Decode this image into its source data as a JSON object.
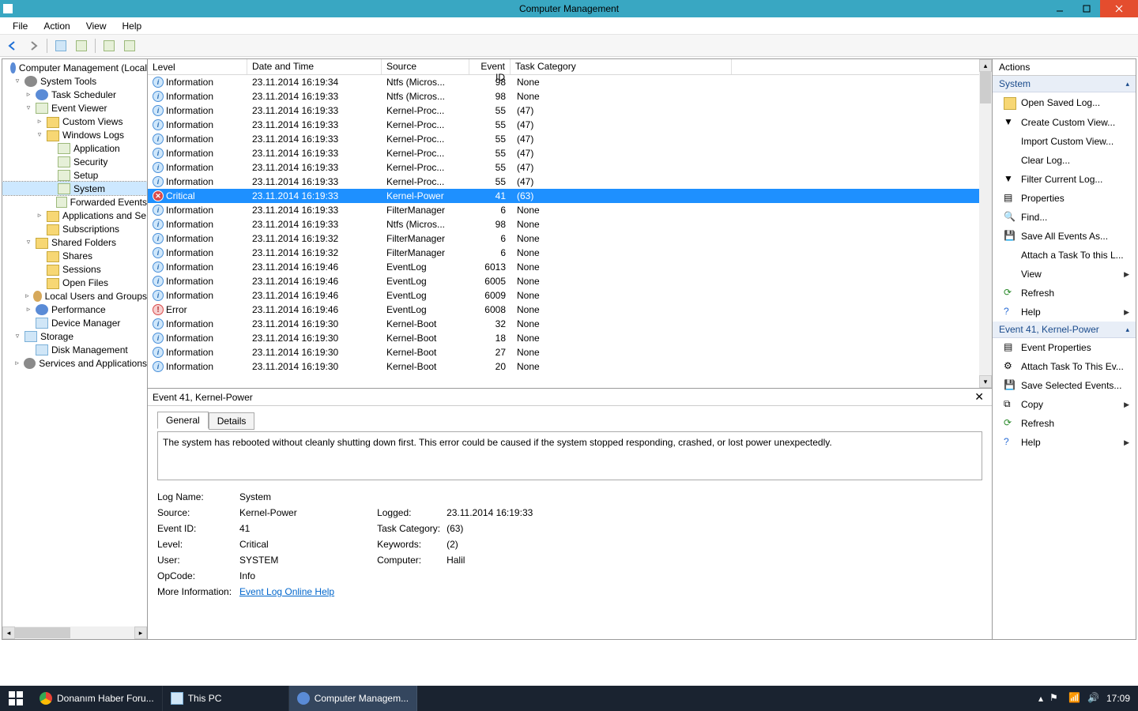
{
  "window": {
    "title": "Computer Management"
  },
  "menu": [
    "File",
    "Action",
    "View",
    "Help"
  ],
  "tree": [
    {
      "lvl": 0,
      "tw": "",
      "icon": "tool",
      "label": "Computer Management (Local"
    },
    {
      "lvl": 1,
      "tw": "▿",
      "icon": "gear",
      "label": "System Tools"
    },
    {
      "lvl": 2,
      "tw": "▹",
      "icon": "tool",
      "label": "Task Scheduler"
    },
    {
      "lvl": 2,
      "tw": "▿",
      "icon": "log",
      "label": "Event Viewer"
    },
    {
      "lvl": 3,
      "tw": "▹",
      "icon": "folder",
      "label": "Custom Views"
    },
    {
      "lvl": 3,
      "tw": "▿",
      "icon": "folder",
      "label": "Windows Logs"
    },
    {
      "lvl": 4,
      "tw": "",
      "icon": "log",
      "label": "Application"
    },
    {
      "lvl": 4,
      "tw": "",
      "icon": "log",
      "label": "Security"
    },
    {
      "lvl": 4,
      "tw": "",
      "icon": "log",
      "label": "Setup"
    },
    {
      "lvl": 4,
      "tw": "",
      "icon": "log",
      "label": "System",
      "selected": true
    },
    {
      "lvl": 4,
      "tw": "",
      "icon": "log",
      "label": "Forwarded Events"
    },
    {
      "lvl": 3,
      "tw": "▹",
      "icon": "folder",
      "label": "Applications and Se"
    },
    {
      "lvl": 3,
      "tw": "",
      "icon": "folder",
      "label": "Subscriptions"
    },
    {
      "lvl": 2,
      "tw": "▿",
      "icon": "folder",
      "label": "Shared Folders"
    },
    {
      "lvl": 3,
      "tw": "",
      "icon": "folder",
      "label": "Shares"
    },
    {
      "lvl": 3,
      "tw": "",
      "icon": "folder",
      "label": "Sessions"
    },
    {
      "lvl": 3,
      "tw": "",
      "icon": "folder",
      "label": "Open Files"
    },
    {
      "lvl": 2,
      "tw": "▹",
      "icon": "people",
      "label": "Local Users and Groups"
    },
    {
      "lvl": 2,
      "tw": "▹",
      "icon": "tool",
      "label": "Performance"
    },
    {
      "lvl": 2,
      "tw": "",
      "icon": "device",
      "label": "Device Manager"
    },
    {
      "lvl": 1,
      "tw": "▿",
      "icon": "device",
      "label": "Storage"
    },
    {
      "lvl": 2,
      "tw": "",
      "icon": "device",
      "label": "Disk Management"
    },
    {
      "lvl": 1,
      "tw": "▹",
      "icon": "gear",
      "label": "Services and Applications"
    }
  ],
  "grid": {
    "cols": [
      "Level",
      "Date and Time",
      "Source",
      "Event ID",
      "Task Category"
    ],
    "rows": [
      {
        "lvl": "Information",
        "dt": "23.11.2014 16:19:34",
        "src": "Ntfs (Micros...",
        "id": 98,
        "cat": "None"
      },
      {
        "lvl": "Information",
        "dt": "23.11.2014 16:19:33",
        "src": "Ntfs (Micros...",
        "id": 98,
        "cat": "None"
      },
      {
        "lvl": "Information",
        "dt": "23.11.2014 16:19:33",
        "src": "Kernel-Proc...",
        "id": 55,
        "cat": "(47)"
      },
      {
        "lvl": "Information",
        "dt": "23.11.2014 16:19:33",
        "src": "Kernel-Proc...",
        "id": 55,
        "cat": "(47)"
      },
      {
        "lvl": "Information",
        "dt": "23.11.2014 16:19:33",
        "src": "Kernel-Proc...",
        "id": 55,
        "cat": "(47)"
      },
      {
        "lvl": "Information",
        "dt": "23.11.2014 16:19:33",
        "src": "Kernel-Proc...",
        "id": 55,
        "cat": "(47)"
      },
      {
        "lvl": "Information",
        "dt": "23.11.2014 16:19:33",
        "src": "Kernel-Proc...",
        "id": 55,
        "cat": "(47)"
      },
      {
        "lvl": "Information",
        "dt": "23.11.2014 16:19:33",
        "src": "Kernel-Proc...",
        "id": 55,
        "cat": "(47)"
      },
      {
        "lvl": "Critical",
        "dt": "23.11.2014 16:19:33",
        "src": "Kernel-Power",
        "id": 41,
        "cat": "(63)",
        "selected": true
      },
      {
        "lvl": "Information",
        "dt": "23.11.2014 16:19:33",
        "src": "FilterManager",
        "id": 6,
        "cat": "None"
      },
      {
        "lvl": "Information",
        "dt": "23.11.2014 16:19:33",
        "src": "Ntfs (Micros...",
        "id": 98,
        "cat": "None"
      },
      {
        "lvl": "Information",
        "dt": "23.11.2014 16:19:32",
        "src": "FilterManager",
        "id": 6,
        "cat": "None"
      },
      {
        "lvl": "Information",
        "dt": "23.11.2014 16:19:32",
        "src": "FilterManager",
        "id": 6,
        "cat": "None"
      },
      {
        "lvl": "Information",
        "dt": "23.11.2014 16:19:46",
        "src": "EventLog",
        "id": 6013,
        "cat": "None"
      },
      {
        "lvl": "Information",
        "dt": "23.11.2014 16:19:46",
        "src": "EventLog",
        "id": 6005,
        "cat": "None"
      },
      {
        "lvl": "Information",
        "dt": "23.11.2014 16:19:46",
        "src": "EventLog",
        "id": 6009,
        "cat": "None"
      },
      {
        "lvl": "Error",
        "dt": "23.11.2014 16:19:46",
        "src": "EventLog",
        "id": 6008,
        "cat": "None"
      },
      {
        "lvl": "Information",
        "dt": "23.11.2014 16:19:30",
        "src": "Kernel-Boot",
        "id": 32,
        "cat": "None"
      },
      {
        "lvl": "Information",
        "dt": "23.11.2014 16:19:30",
        "src": "Kernel-Boot",
        "id": 18,
        "cat": "None"
      },
      {
        "lvl": "Information",
        "dt": "23.11.2014 16:19:30",
        "src": "Kernel-Boot",
        "id": 27,
        "cat": "None"
      },
      {
        "lvl": "Information",
        "dt": "23.11.2014 16:19:30",
        "src": "Kernel-Boot",
        "id": 20,
        "cat": "None"
      }
    ]
  },
  "detail": {
    "title": "Event 41, Kernel-Power",
    "tabs": [
      "General",
      "Details"
    ],
    "description": "The system has rebooted without cleanly shutting down first. This error could be caused if the system stopped responding, crashed, or lost power unexpectedly.",
    "props": {
      "log_name_k": "Log Name:",
      "log_name_v": "System",
      "source_k": "Source:",
      "source_v": "Kernel-Power",
      "logged_k": "Logged:",
      "logged_v": "23.11.2014 16:19:33",
      "event_id_k": "Event ID:",
      "event_id_v": "41",
      "task_cat_k": "Task Category:",
      "task_cat_v": "(63)",
      "level_k": "Level:",
      "level_v": "Critical",
      "keywords_k": "Keywords:",
      "keywords_v": "(2)",
      "user_k": "User:",
      "user_v": "SYSTEM",
      "computer_k": "Computer:",
      "computer_v": "Halil",
      "opcode_k": "OpCode:",
      "opcode_v": "Info",
      "more_info_k": "More Information:",
      "more_info_v": "Event Log Online Help"
    }
  },
  "actions": {
    "title": "Actions",
    "section1": "System",
    "section2": "Event 41, Kernel-Power",
    "items1": [
      {
        "label": "Open Saved Log...",
        "icon": "folder"
      },
      {
        "label": "Create Custom View...",
        "icon": "filter"
      },
      {
        "label": "Import Custom View...",
        "icon": ""
      },
      {
        "label": "Clear Log...",
        "icon": ""
      },
      {
        "label": "Filter Current Log...",
        "icon": "filter"
      },
      {
        "label": "Properties",
        "icon": "props"
      },
      {
        "label": "Find...",
        "icon": "find"
      },
      {
        "label": "Save All Events As...",
        "icon": "save"
      },
      {
        "label": "Attach a Task To this L...",
        "icon": ""
      },
      {
        "label": "View",
        "icon": "",
        "arrow": true
      },
      {
        "label": "Refresh",
        "icon": "refresh"
      },
      {
        "label": "Help",
        "icon": "help",
        "arrow": true
      }
    ],
    "items2": [
      {
        "label": "Event Properties",
        "icon": "props"
      },
      {
        "label": "Attach Task To This Ev...",
        "icon": "task"
      },
      {
        "label": "Save Selected Events...",
        "icon": "save"
      },
      {
        "label": "Copy",
        "icon": "copy",
        "arrow": true
      },
      {
        "label": "Refresh",
        "icon": "refresh"
      },
      {
        "label": "Help",
        "icon": "help",
        "arrow": true
      }
    ]
  },
  "taskbar": {
    "buttons": [
      {
        "label": "Donanım Haber Foru...",
        "icon": "chrome"
      },
      {
        "label": "This PC",
        "icon": "pc"
      },
      {
        "label": "Computer Managem...",
        "icon": "mmc",
        "active": true
      }
    ],
    "time": "17:09"
  }
}
